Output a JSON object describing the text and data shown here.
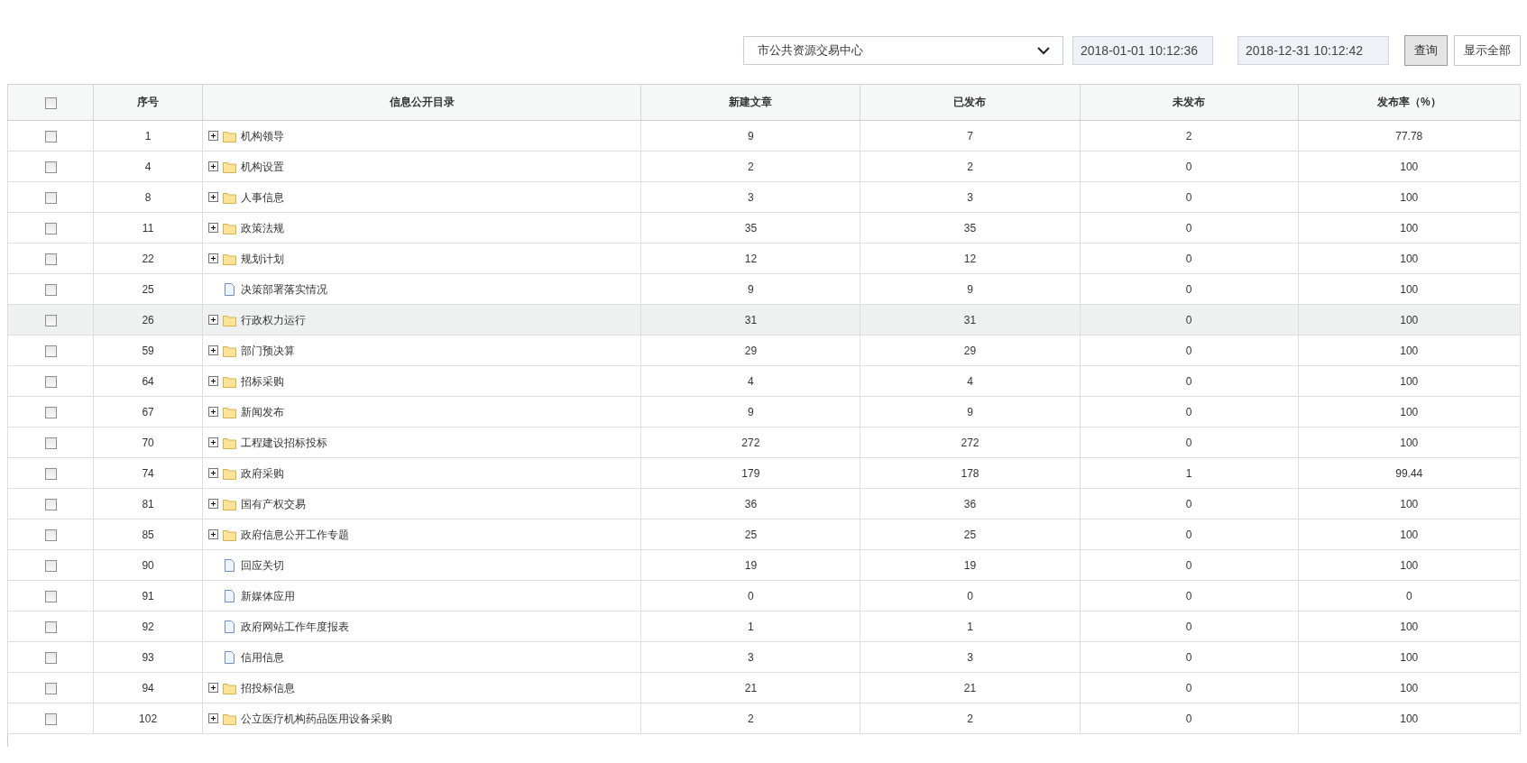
{
  "toolbar": {
    "organization": "市公共资源交易中心",
    "start_date": "2018-01-01 10:12:36",
    "end_date": "2018-12-31 10:12:42",
    "buttons": [
      "查询",
      "显示全部"
    ]
  },
  "table": {
    "select_all_checked": false,
    "columns": [
      "序号",
      "信息公开目录",
      "新建文章",
      "已发布",
      "未发布",
      "发布率（%）"
    ],
    "rows": [
      {
        "checked": false,
        "highlighted": false,
        "kind": "folder",
        "cells": [
          "1",
          "机构领导",
          "9",
          "7",
          "2",
          "77.78"
        ]
      },
      {
        "checked": false,
        "highlighted": false,
        "kind": "folder",
        "cells": [
          "4",
          "机构设置",
          "2",
          "2",
          "0",
          "100"
        ]
      },
      {
        "checked": false,
        "highlighted": false,
        "kind": "folder",
        "cells": [
          "8",
          "人事信息",
          "3",
          "3",
          "0",
          "100"
        ]
      },
      {
        "checked": false,
        "highlighted": false,
        "kind": "folder",
        "cells": [
          "11",
          "政策法规",
          "35",
          "35",
          "0",
          "100"
        ]
      },
      {
        "checked": false,
        "highlighted": false,
        "kind": "folder",
        "cells": [
          "22",
          "规划计划",
          "12",
          "12",
          "0",
          "100"
        ]
      },
      {
        "checked": false,
        "highlighted": false,
        "kind": "file",
        "cells": [
          "25",
          "决策部署落实情况",
          "9",
          "9",
          "0",
          "100"
        ]
      },
      {
        "checked": false,
        "highlighted": true,
        "kind": "folder",
        "cells": [
          "26",
          "行政权力运行",
          "31",
          "31",
          "0",
          "100"
        ]
      },
      {
        "checked": false,
        "highlighted": false,
        "kind": "folder",
        "cells": [
          "59",
          "部门预决算",
          "29",
          "29",
          "0",
          "100"
        ]
      },
      {
        "checked": false,
        "highlighted": false,
        "kind": "folder",
        "cells": [
          "64",
          "招标采购",
          "4",
          "4",
          "0",
          "100"
        ]
      },
      {
        "checked": false,
        "highlighted": false,
        "kind": "folder",
        "cells": [
          "67",
          "新闻发布",
          "9",
          "9",
          "0",
          "100"
        ]
      },
      {
        "checked": false,
        "highlighted": false,
        "kind": "folder",
        "cells": [
          "70",
          "工程建设招标投标",
          "272",
          "272",
          "0",
          "100"
        ]
      },
      {
        "checked": false,
        "highlighted": false,
        "kind": "folder",
        "cells": [
          "74",
          "政府采购",
          "179",
          "178",
          "1",
          "99.44"
        ]
      },
      {
        "checked": false,
        "highlighted": false,
        "kind": "folder",
        "cells": [
          "81",
          "国有产权交易",
          "36",
          "36",
          "0",
          "100"
        ]
      },
      {
        "checked": false,
        "highlighted": false,
        "kind": "folder",
        "cells": [
          "85",
          "政府信息公开工作专题",
          "25",
          "25",
          "0",
          "100"
        ]
      },
      {
        "checked": false,
        "highlighted": false,
        "kind": "file",
        "cells": [
          "90",
          "回应关切",
          "19",
          "19",
          "0",
          "100"
        ]
      },
      {
        "checked": false,
        "highlighted": false,
        "kind": "file",
        "cells": [
          "91",
          "新媒体应用",
          "0",
          "0",
          "0",
          "0"
        ]
      },
      {
        "checked": false,
        "highlighted": false,
        "kind": "file",
        "cells": [
          "92",
          "政府网站工作年度报表",
          "1",
          "1",
          "0",
          "100"
        ]
      },
      {
        "checked": false,
        "highlighted": false,
        "kind": "file",
        "cells": [
          "93",
          "信用信息",
          "3",
          "3",
          "0",
          "100"
        ]
      },
      {
        "checked": false,
        "highlighted": false,
        "kind": "folder",
        "cells": [
          "94",
          "招投标信息",
          "21",
          "21",
          "0",
          "100"
        ]
      },
      {
        "checked": false,
        "highlighted": false,
        "kind": "folder",
        "cells": [
          "102",
          "公立医疗机构药品医用设备采购",
          "2",
          "2",
          "0",
          "100"
        ]
      }
    ]
  }
}
